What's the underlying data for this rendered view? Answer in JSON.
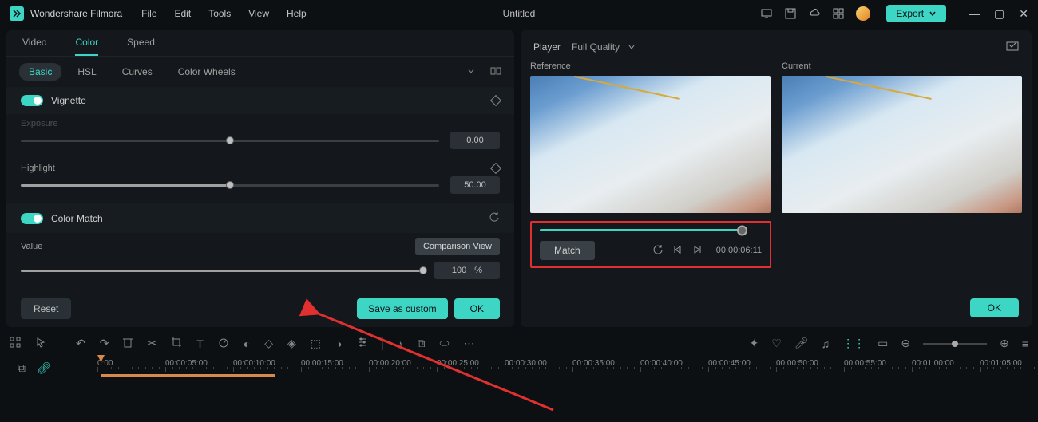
{
  "app": {
    "name": "Wondershare Filmora",
    "doc_title": "Untitled"
  },
  "menu": [
    "File",
    "Edit",
    "Tools",
    "View",
    "Help"
  ],
  "export_label": "Export",
  "top_tabs": [
    "Video",
    "Color",
    "Speed"
  ],
  "top_tabs_active": "Color",
  "sub_tabs": [
    "Basic",
    "HSL",
    "Curves",
    "Color Wheels"
  ],
  "sub_tabs_active": "Basic",
  "sections": {
    "vignette_label": "Vignette",
    "exposure_label": "Exposure",
    "exposure_value": "0.00",
    "highlight_label": "Highlight",
    "highlight_value": "50.00",
    "color_match_label": "Color Match",
    "value_label": "Value",
    "value_value": "100",
    "value_unit": "%",
    "comparison_view": "Comparison View"
  },
  "footer": {
    "reset": "Reset",
    "save_custom": "Save as custom",
    "ok": "OK"
  },
  "player": {
    "label": "Player",
    "quality": "Full Quality",
    "reference": "Reference",
    "current": "Current",
    "match_btn": "Match",
    "timecode": "00:00:06:11",
    "ok": "OK"
  },
  "timeline_labels": [
    "0:00",
    "00:00:05:00",
    "00:00:10:00",
    "00:00:15:00",
    "00:00:20:00",
    "00:00:25:00",
    "00:00:30:00",
    "00:00:35:00",
    "00:00:40:00",
    "00:00:45:00",
    "00:00:50:00",
    "00:00:55:00",
    "00:01:00:00",
    "00:01:05:00"
  ]
}
